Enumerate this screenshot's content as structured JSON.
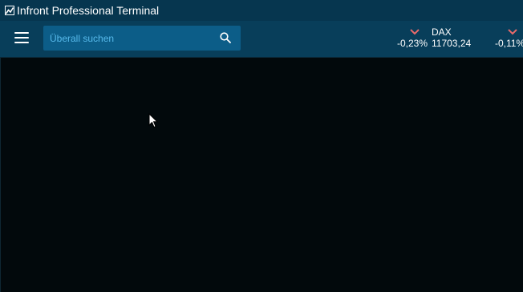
{
  "window": {
    "title": "Infront Professional Terminal"
  },
  "toolbar": {
    "search": {
      "placeholder": "Überall suchen",
      "value": ""
    },
    "tickers": [
      {
        "name": "",
        "change": "-0,23%",
        "value": "",
        "direction": "down"
      },
      {
        "name": "DAX",
        "change": "",
        "value": "11703,24",
        "direction": ""
      },
      {
        "name": "",
        "change": "-0,11%",
        "value": "",
        "direction": "down"
      }
    ]
  },
  "colors": {
    "titlebar": "#06364f",
    "toolbar": "#083e5a",
    "search_bg": "#0c5d88",
    "placeholder": "#56b9ea",
    "content_bg": "#02090c",
    "down_arrow": "#e86a6a"
  },
  "icons": {
    "app": "app-logo-icon",
    "menu": "hamburger-menu-icon",
    "search": "search-icon",
    "down": "chevron-down-icon",
    "pointer": "mouse-cursor-icon"
  }
}
